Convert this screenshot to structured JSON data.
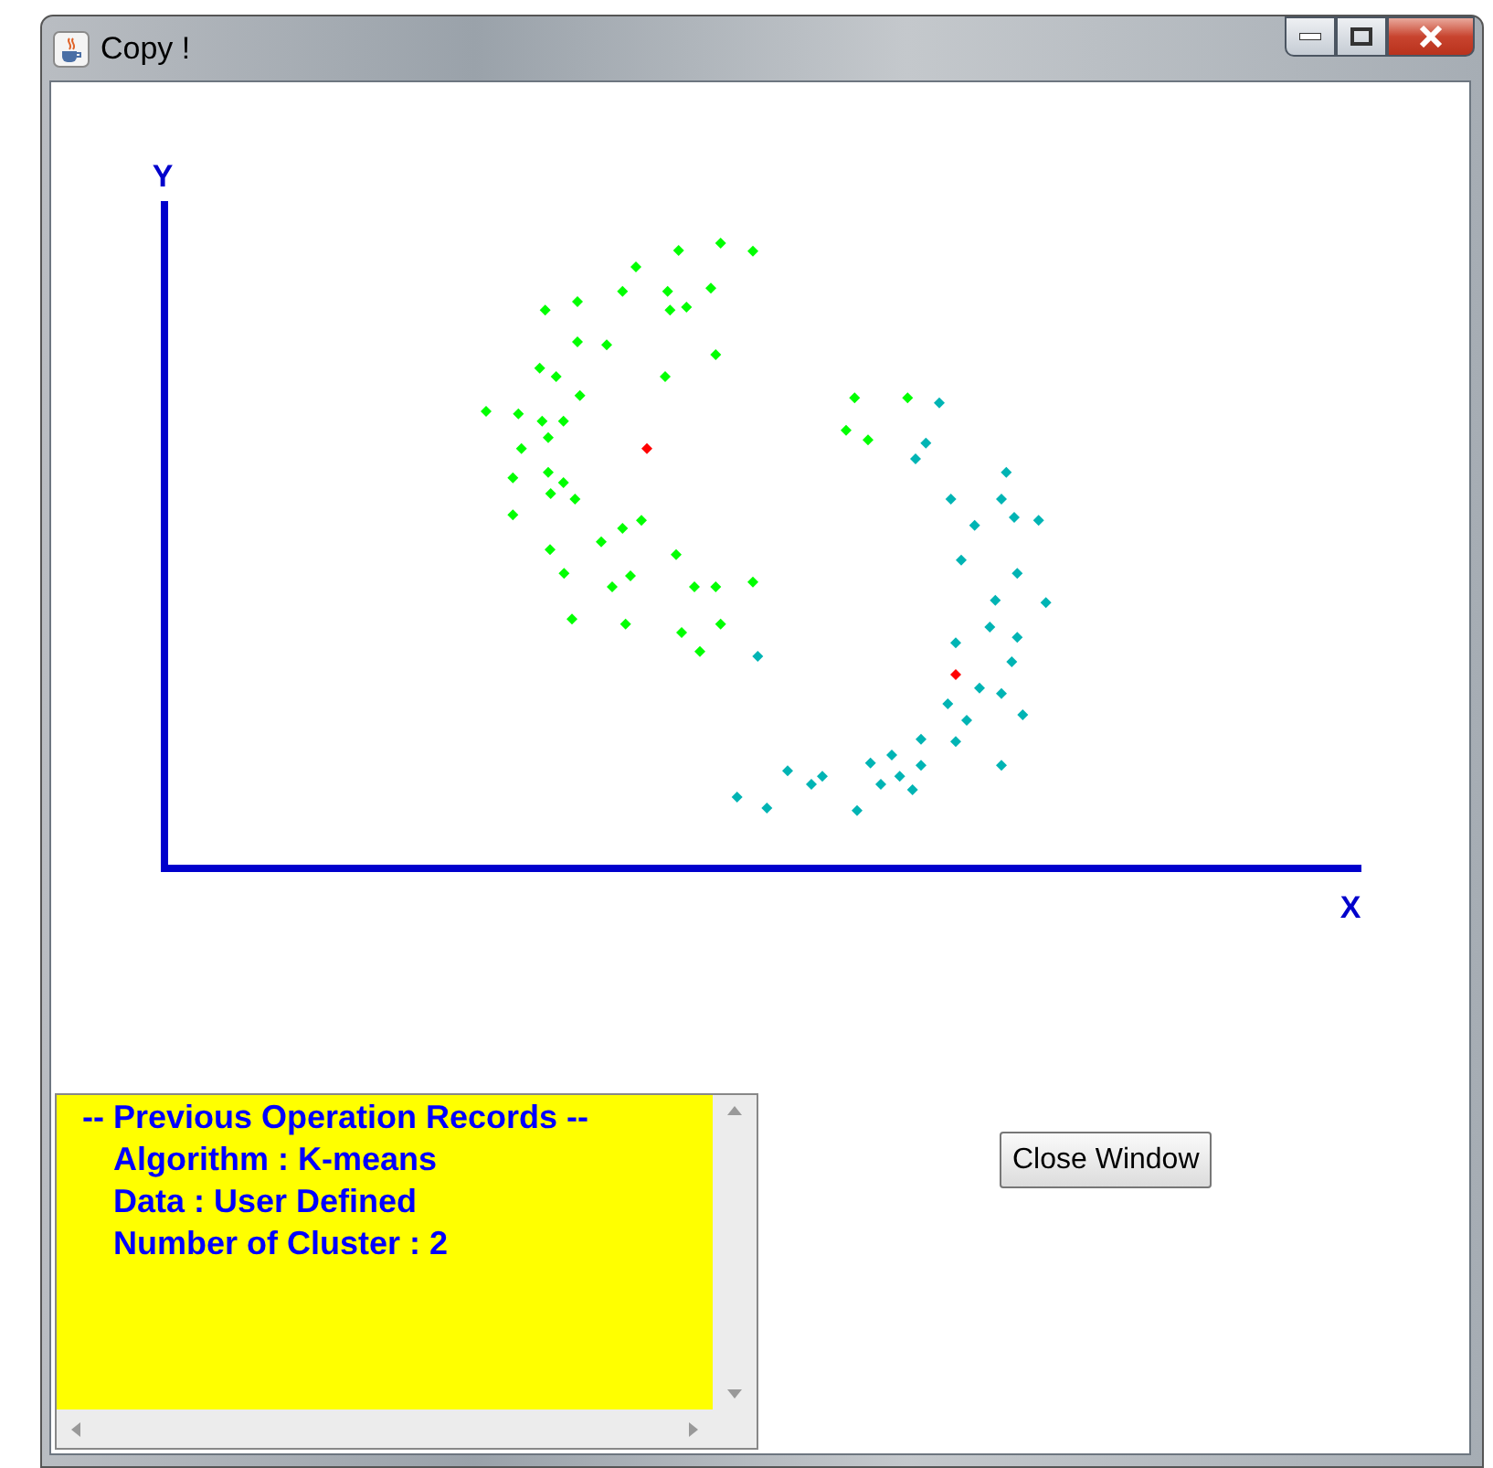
{
  "window": {
    "title": "Copy !"
  },
  "plot": {
    "y_label": "Y",
    "x_label": "X",
    "clusters": [
      {
        "color": "#00ff00"
      },
      {
        "color": "#00b4b4"
      }
    ]
  },
  "records": {
    "heading": "-- Previous Operation Records --",
    "lines": [
      "Algorithm : K-means",
      "Data : User Defined",
      "Number of Cluster : 2"
    ]
  },
  "buttons": [
    "Close Window"
  ]
}
